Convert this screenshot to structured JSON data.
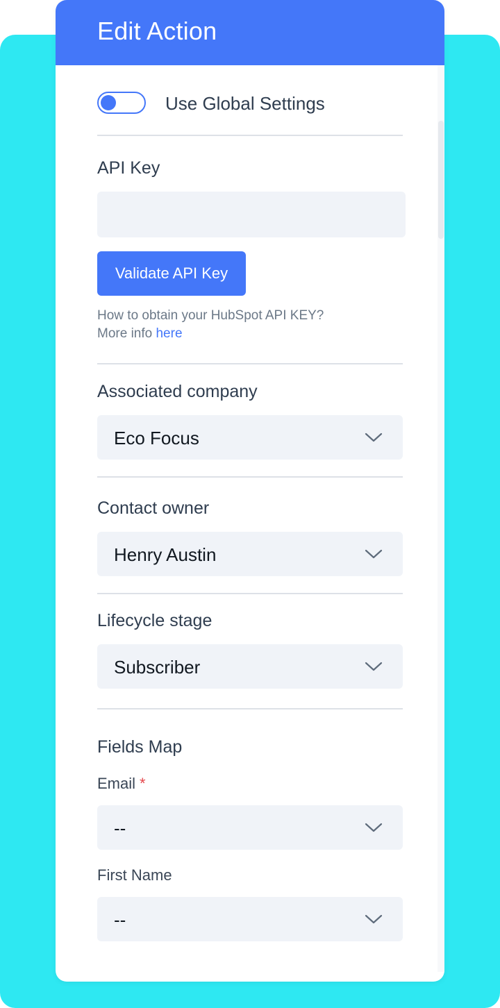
{
  "colors": {
    "accent": "#4477f9",
    "backdrop": "#2ee8f2",
    "required": "#e5484d"
  },
  "panel": {
    "title": "Edit Action"
  },
  "global_settings": {
    "label": "Use Global Settings",
    "enabled": false
  },
  "api_key": {
    "label": "API Key",
    "value": "",
    "validate_label": "Validate API Key",
    "help_line1": "How to obtain your HubSpot API KEY?",
    "help_line2_prefix": "More info",
    "help_link": "here"
  },
  "associated_company": {
    "label": "Associated company",
    "value": "Eco Focus",
    "icon": "chevron-down-icon"
  },
  "contact_owner": {
    "label": "Contact owner",
    "value": "Henry Austin",
    "icon": "chevron-down-icon"
  },
  "lifecycle_stage": {
    "label": "Lifecycle stage",
    "value": "Subscriber",
    "icon": "chevron-down-icon"
  },
  "fields_map": {
    "title": "Fields Map",
    "email": {
      "label": "Email",
      "required_mark": "*",
      "value": "--"
    },
    "first_name": {
      "label": "First Name",
      "value": "--"
    }
  }
}
